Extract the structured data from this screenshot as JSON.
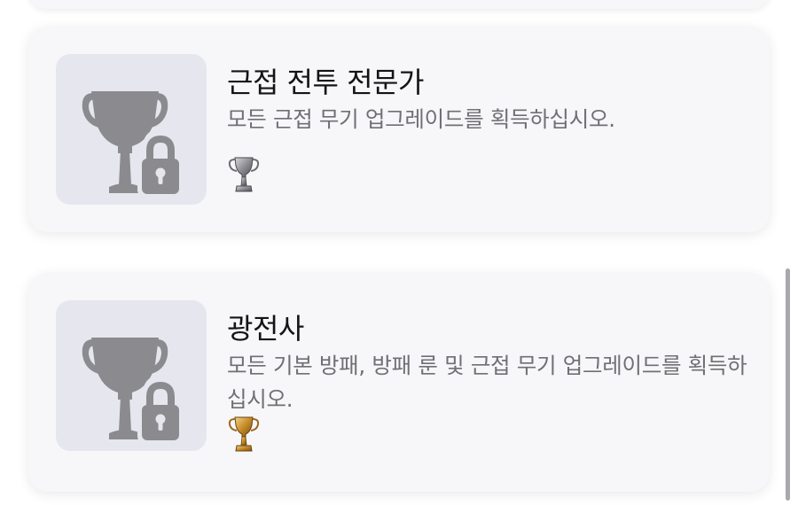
{
  "achievements": [
    {
      "title": "근접 전투 전문가",
      "description": "모든 근접 무기 업그레이드를 획득하십시오.",
      "status_icon": "locked-trophy-icon",
      "rank_icon": "silver-trophy-icon",
      "rank_color": "#8c8c92"
    },
    {
      "title": "광전사",
      "description": "모든 기본 방패, 방패 룬 및 근접 무기 업그레이드를 획득하십시오.",
      "status_icon": "locked-trophy-icon",
      "rank_icon": "gold-trophy-icon",
      "rank_color": "#c48a26"
    }
  ],
  "colors": {
    "card_background": "#f7f7f9",
    "thumb_background": "#e6e6ef",
    "locked_icon": "#8b8b8f",
    "title_text": "#141414",
    "description_text": "#6f6f74"
  }
}
